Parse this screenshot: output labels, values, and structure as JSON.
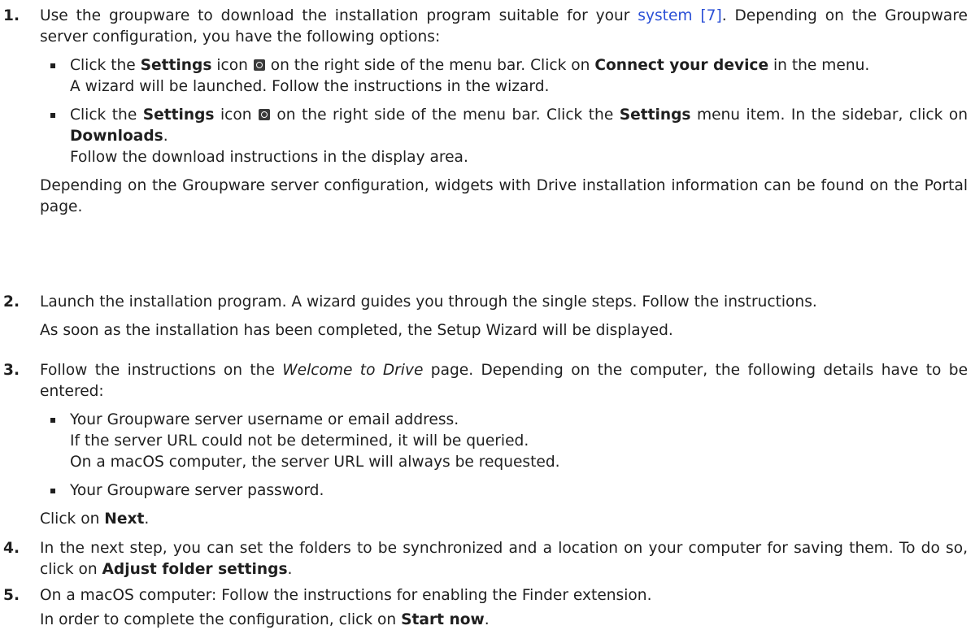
{
  "steps": [
    {
      "number": "1.",
      "intro_before_link": "Use the groupware to download the installation program suitable for your ",
      "intro_link": "system [7]",
      "intro_after_link": ". Depending on the Groupware server configuration, you have the following options:",
      "bullets": [
        {
          "t1": "Click the ",
          "b1": "Settings",
          "t2": " icon ",
          "icon": "settings-gear-icon",
          "t3": " on the right side of the menu bar. Click on ",
          "b2": "Connect your device",
          "t4": " in the menu.",
          "line2": "A wizard will be launched. Follow the instructions in the wizard."
        },
        {
          "t1": "Click the ",
          "b1": "Settings",
          "t2": " icon ",
          "icon": "settings-gear-icon",
          "t3": " on the right side of the menu bar. Click the ",
          "b2": "Settings",
          "t4": " menu item. In the sidebar, click on ",
          "b3": "Downloads",
          "t5": ".",
          "line2": "Follow the download instructions in the display area."
        }
      ],
      "outro": "Depending on the Groupware server configuration, widgets with Drive installation information can be found on the Portal page."
    },
    {
      "number": "2.",
      "line1": "Launch the installation program. A wizard guides you through the single steps. Follow the instructions.",
      "line2": "As soon as the installation has been completed, the Setup Wizard will be displayed."
    },
    {
      "number": "3.",
      "intro_before": "Follow the instructions on the ",
      "intro_italic": "Welcome to Drive",
      "intro_after": " page. Depending on the computer, the following details have to be entered:",
      "bullets": [
        {
          "line1": "Your Groupware server username or email address.",
          "line2": "If the server URL could not be determined, it will be queried.",
          "line3": "On a macOS computer, the server URL will always be requested."
        },
        {
          "line1": "Your Groupware server password."
        }
      ],
      "outro_before": "Click on ",
      "outro_bold": "Next",
      "outro_after": "."
    },
    {
      "number": "4.",
      "text_before": "In the next step, you can set the folders to be synchronized and a location on your computer for saving them. To do so, click on ",
      "text_bold": "Adjust folder settings",
      "text_after": "."
    },
    {
      "number": "5.",
      "line1": "On a macOS computer: Follow the instructions for enabling the Finder extension.",
      "line2_before": "In order to complete the configuration, click on ",
      "line2_bold": "Start now",
      "line2_after": "."
    }
  ]
}
